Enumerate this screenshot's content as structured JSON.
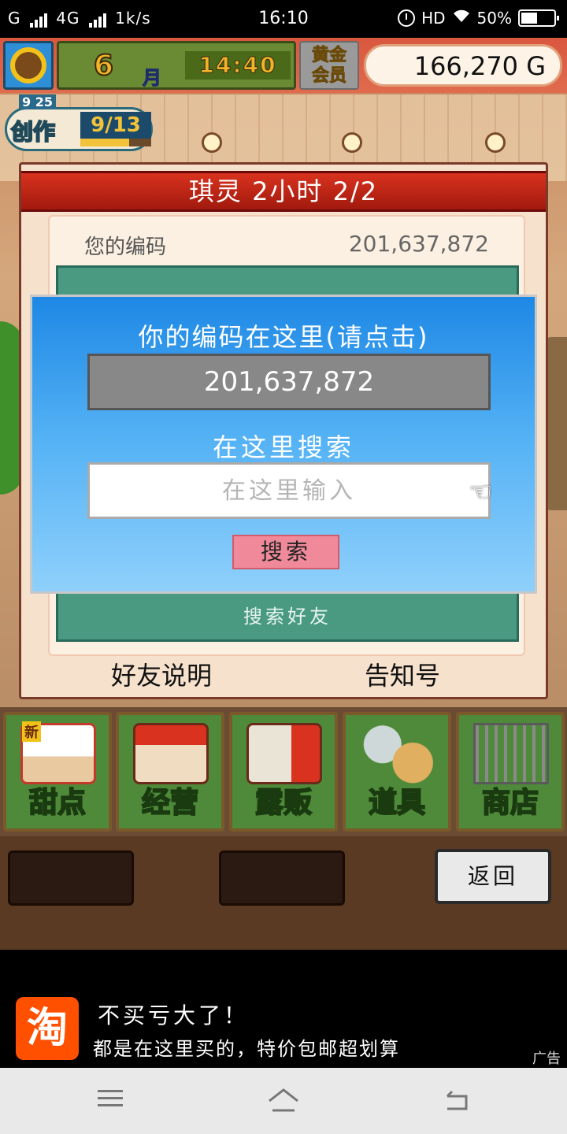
{
  "status_bar": {
    "carrier": "G",
    "network": "4G",
    "speed": "1k/s",
    "time": "16:10",
    "hd": "HD",
    "battery": "50%",
    "battery_level": 0.5
  },
  "hud": {
    "month": "6",
    "month_unit": "月",
    "time": "14:40",
    "gold_member": [
      "黄金",
      "会员"
    ],
    "money": "166,270 G",
    "create_label": "创作",
    "create_small": "9 25",
    "create_count": "9/13",
    "create_progress": 0.69
  },
  "panel": {
    "title": "琪灵  2小时 2/2",
    "code_label": "您的编码",
    "code_value": "201,637,872",
    "green_bottom": "搜索好友",
    "link_friends": "好友说明",
    "link_notice": "告知号"
  },
  "dialog": {
    "title": "你的编码在这里(请点击)",
    "code": "201,637,872",
    "search_label": "在这里搜索",
    "search_placeholder": "在这里输入",
    "search_button": "搜索"
  },
  "menu": {
    "new_tag": "新",
    "items": [
      {
        "label": "甜点",
        "icon": "cake-icon"
      },
      {
        "label": "经营",
        "icon": "shop-icon"
      },
      {
        "label": "露贩",
        "icon": "food-truck-icon"
      },
      {
        "label": "道具",
        "icon": "item-bag-icon"
      },
      {
        "label": "商店",
        "icon": "cart-icon"
      }
    ]
  },
  "back_button": "返回",
  "ad": {
    "logo": "淘",
    "title": "不买亏大了！",
    "subtitle": "都是在这里买的，特价包邮超划算",
    "tag": "广告"
  },
  "colors": {
    "dialog_top": "#1e88e5",
    "panel_title": "#c0271a",
    "search_button": "#f08a9a",
    "money_bg": "#fdf3e7"
  }
}
